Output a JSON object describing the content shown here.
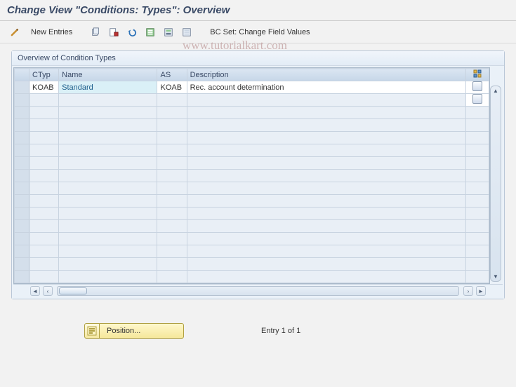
{
  "header": {
    "title": "Change View \"Conditions: Types\": Overview"
  },
  "toolbar": {
    "new_entries": "New Entries",
    "bc_set": "BC Set: Change Field Values",
    "icons": {
      "toggle": "toggle-icon",
      "copy": "copy-icon",
      "delete": "delete-icon",
      "undo": "undo-icon",
      "select_all": "select-all-icon",
      "select_block": "select-block-icon",
      "deselect_all": "deselect-all-icon"
    }
  },
  "panel": {
    "title": "Overview of Condition Types",
    "columns": {
      "ctyp": "CTyp",
      "name": "Name",
      "as": "AS",
      "description": "Description"
    },
    "rows": [
      {
        "ctyp": "KOAB",
        "name": "Standard",
        "as": "KOAB",
        "description": "Rec. account determination"
      }
    ],
    "empty_row_count": 15
  },
  "footer": {
    "position_label": "Position...",
    "entry_text": "Entry 1 of 1"
  },
  "watermark": "www.tutorialkart.com"
}
